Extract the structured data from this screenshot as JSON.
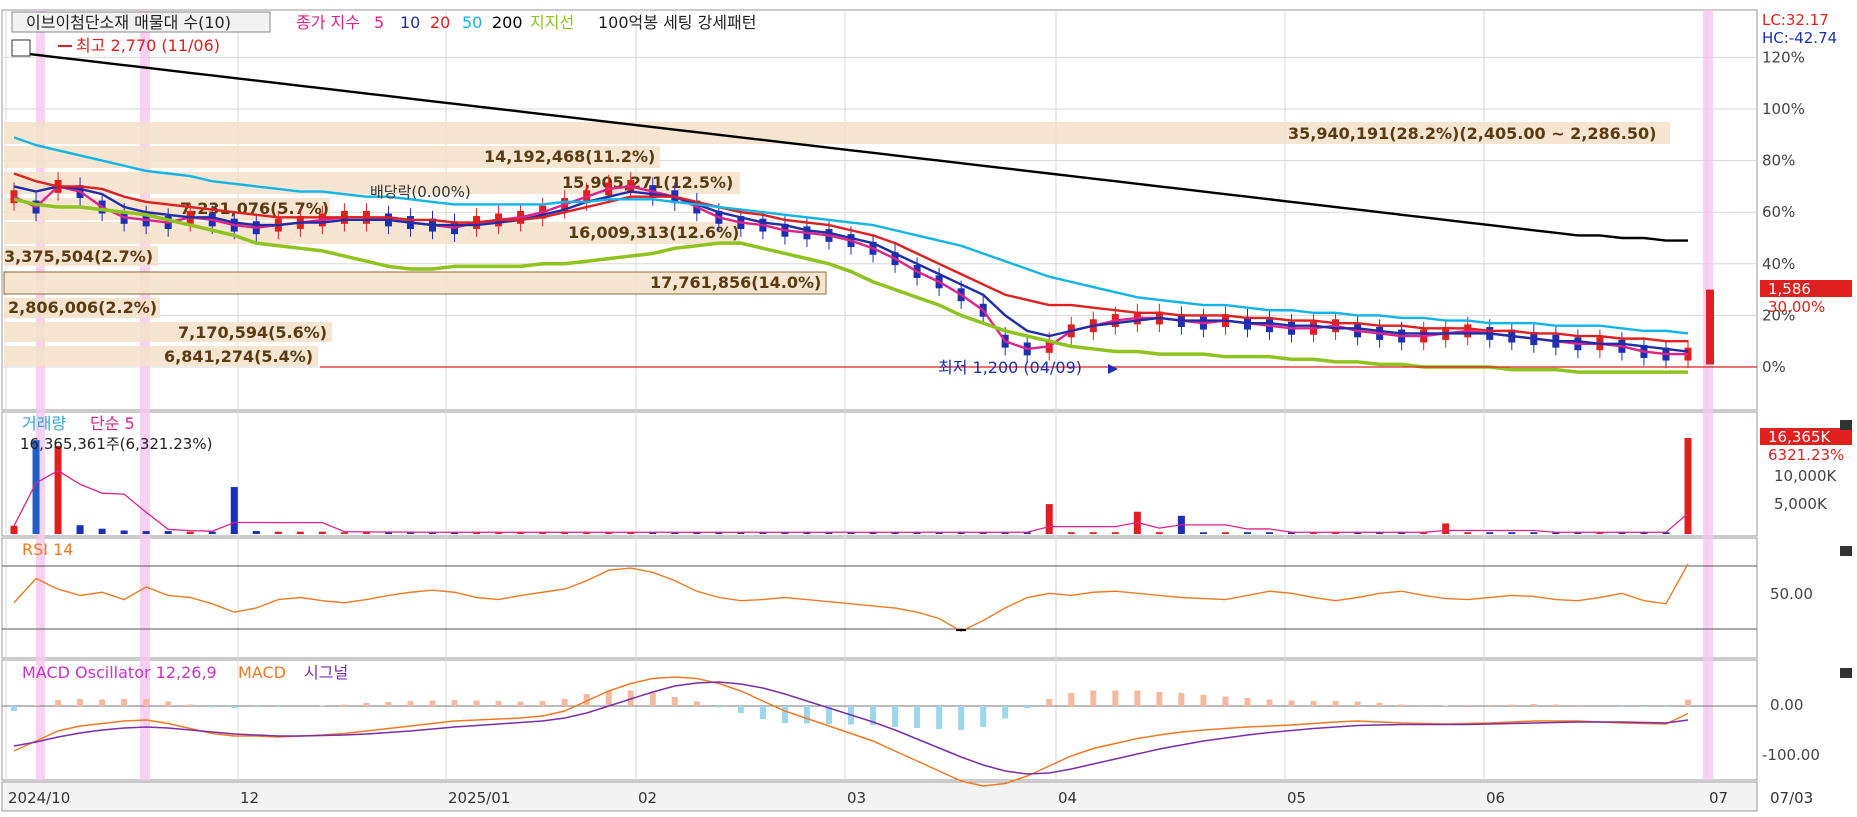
{
  "main_panel": {
    "stock_name": "이브이첨단소재 매물대 수(10)",
    "indicators": [
      {
        "label": "종가 지수",
        "color": "#e0218a"
      },
      {
        "label": "5",
        "color": "#e0218a"
      },
      {
        "label": "10",
        "color": "#1f2ea8"
      },
      {
        "label": "20",
        "color": "#e02020"
      },
      {
        "label": "50",
        "color": "#11b4e8"
      },
      {
        "label": "200",
        "color": "#000000"
      },
      {
        "label": "지지선",
        "color": "#8fc31f"
      },
      {
        "label": "100억봉 세팅 강세패턴",
        "color": "#222222"
      }
    ],
    "right_info": [
      "LC:32.17",
      "HC:-42.74"
    ],
    "high_marker": "최고 2,770 (11/06)",
    "low_marker": "최저 1,200 (04/09)",
    "dividend_marker": "배당락(0.00%)",
    "y_axis": [
      "120%",
      "100%",
      "80%",
      "60%",
      "40%",
      "20%",
      "0%"
    ],
    "price_badge": "1,586",
    "pct_badge": "30.00%"
  },
  "volume_profile": [
    {
      "label": "35,940,191(28.2%)(2,405.00 ~ 2,286.50)"
    },
    {
      "label": "14,192,468(11.2%)"
    },
    {
      "label": "15,905,271(12.5%)"
    },
    {
      "label": "7,231,076(5.7%)"
    },
    {
      "label": "16,009,313(12.6%)"
    },
    {
      "label": "3,375,504(2.7%)"
    },
    {
      "label": "17,761,856(14.0%)"
    },
    {
      "label": "2,806,006(2.2%)"
    },
    {
      "label": "7,170,594(5.6%)"
    },
    {
      "label": "6,841,274(5.4%)"
    }
  ],
  "volume_panel": {
    "title": "거래량",
    "ma_label": "단순 5",
    "info": "16,365,361주(6,321.23%)",
    "y_axis": [
      "10,000K",
      "5,000K"
    ],
    "badge1": "16,365K",
    "badge2": "6321.23%"
  },
  "rsi_panel": {
    "title": "RSI 14",
    "y_axis": [
      "50.00"
    ]
  },
  "macd_panel": {
    "title_osc": "MACD Oscillator 12,26,9",
    "title_macd": "MACD",
    "title_signal": "시그널",
    "y_axis": [
      "0.00",
      "-100.00"
    ]
  },
  "x_axis": [
    {
      "label": "2024/10"
    },
    {
      "label": "12"
    },
    {
      "label": "2025/01"
    },
    {
      "label": "02"
    },
    {
      "label": "03"
    },
    {
      "label": "04"
    },
    {
      "label": "05"
    },
    {
      "label": "06"
    },
    {
      "label": "07"
    }
  ],
  "x_axis_right": "07/03",
  "chart_data": {
    "type": "line",
    "x_axis_months": [
      "2024/10",
      "12",
      "2025/01",
      "02",
      "03",
      "04",
      "05",
      "06",
      "07"
    ],
    "price_high": 2770,
    "price_high_date": "11/06",
    "price_low": 1200,
    "price_low_date": "04/09",
    "price_last": 1586,
    "change_pct_last": 30.0,
    "y_axis_pct": [
      120,
      100,
      80,
      60,
      40,
      20,
      0
    ],
    "series": [
      {
        "name": "5",
        "color": "#e0218a",
        "y_pct": [
          66,
          62,
          70,
          68,
          62,
          58,
          57,
          56,
          58,
          57,
          55,
          54,
          55,
          56,
          57,
          58,
          58,
          57,
          56,
          55,
          54,
          56,
          57,
          58,
          60,
          63,
          66,
          69,
          70,
          68,
          66,
          62,
          58,
          56,
          55,
          53,
          52,
          51,
          49,
          46,
          42,
          37,
          33,
          28,
          22,
          10,
          7,
          8,
          14,
          16,
          18,
          19,
          19,
          18,
          17,
          18,
          17,
          16,
          15,
          15,
          16,
          14,
          13,
          12,
          12,
          13,
          14,
          13,
          12,
          11,
          10,
          9,
          9,
          8,
          6,
          5,
          5
        ]
      },
      {
        "name": "10",
        "color": "#1f2ea8",
        "y_pct": [
          70,
          68,
          70,
          69,
          67,
          62,
          60,
          59,
          58,
          58,
          56,
          55,
          55,
          56,
          56,
          57,
          57,
          57,
          56,
          55,
          55,
          55,
          56,
          57,
          59,
          61,
          64,
          66,
          68,
          67,
          66,
          63,
          60,
          58,
          56,
          55,
          53,
          52,
          50,
          48,
          44,
          40,
          36,
          32,
          28,
          20,
          14,
          12,
          14,
          16,
          17,
          18,
          19,
          18,
          18,
          18,
          17,
          17,
          16,
          16,
          15,
          15,
          14,
          13,
          13,
          13,
          13,
          13,
          12,
          11,
          10,
          10,
          9,
          9,
          8,
          7,
          6
        ]
      },
      {
        "name": "20",
        "color": "#e02020",
        "y_pct": [
          75,
          72,
          70,
          70,
          69,
          66,
          64,
          63,
          62,
          61,
          60,
          59,
          58,
          58,
          58,
          58,
          58,
          58,
          57,
          57,
          56,
          56,
          57,
          57,
          58,
          60,
          62,
          64,
          66,
          66,
          66,
          64,
          62,
          60,
          59,
          57,
          56,
          55,
          53,
          51,
          48,
          44,
          40,
          36,
          32,
          28,
          26,
          24,
          24,
          23,
          22,
          21,
          21,
          20,
          20,
          20,
          19,
          19,
          18,
          18,
          17,
          17,
          16,
          16,
          15,
          15,
          15,
          14,
          14,
          13,
          13,
          12,
          12,
          11,
          11,
          10,
          10
        ]
      },
      {
        "name": "50",
        "color": "#11b4e8",
        "y_pct": [
          89,
          86,
          84,
          82,
          80,
          78,
          76,
          75,
          74,
          72,
          71,
          70,
          69,
          68,
          68,
          67,
          66,
          66,
          65,
          64,
          63,
          63,
          63,
          63,
          63,
          64,
          64,
          65,
          65,
          65,
          64,
          63,
          62,
          61,
          60,
          59,
          58,
          57,
          56,
          55,
          53,
          51,
          49,
          47,
          44,
          41,
          38,
          35,
          33,
          31,
          29,
          27,
          26,
          25,
          24,
          24,
          23,
          22,
          22,
          21,
          21,
          20,
          20,
          19,
          19,
          18,
          18,
          17,
          17,
          17,
          16,
          16,
          16,
          15,
          14,
          14,
          13
        ]
      },
      {
        "name": "200",
        "color": "#000000",
        "y_pct": [
          122,
          121,
          120,
          119,
          118,
          117,
          116,
          115,
          114,
          113,
          112,
          111,
          110,
          109,
          108,
          107,
          106,
          105,
          104,
          103,
          102,
          101,
          100,
          99,
          98,
          97,
          96,
          95,
          94,
          93,
          92,
          91,
          90,
          89,
          88,
          87,
          86,
          85,
          84,
          83,
          82,
          81,
          80,
          79,
          78,
          77,
          76,
          75,
          74,
          73,
          72,
          71,
          70,
          69,
          68,
          67,
          66,
          65,
          64,
          63,
          62,
          61,
          60,
          59,
          58,
          57,
          56,
          55,
          54,
          53,
          52,
          51,
          51,
          50,
          50,
          49,
          49
        ]
      },
      {
        "name": "지지선",
        "color": "#8fc31f",
        "y_pct": [
          65,
          63,
          62,
          62,
          61,
          60,
          59,
          57,
          55,
          53,
          51,
          48,
          47,
          46,
          45,
          43,
          41,
          39,
          38,
          38,
          39,
          39,
          39,
          39,
          40,
          40,
          41,
          42,
          43,
          44,
          46,
          47,
          48,
          48,
          46,
          44,
          42,
          40,
          37,
          33,
          30,
          27,
          24,
          20,
          17,
          14,
          12,
          10,
          8,
          7,
          6,
          6,
          5,
          5,
          5,
          4,
          4,
          4,
          3,
          3,
          2,
          2,
          1,
          1,
          0,
          0,
          0,
          0,
          -1,
          -1,
          -1,
          -2,
          -2,
          -2,
          -2,
          -2,
          -2
        ]
      }
    ],
    "volume_k": [
      1400,
      16000,
      15000,
      1500,
      900,
      600,
      500,
      500,
      400,
      400,
      8000,
      500,
      400,
      400,
      400,
      300,
      300,
      300,
      300,
      300,
      300,
      300,
      300,
      300,
      300,
      300,
      300,
      300,
      300,
      300,
      300,
      300,
      300,
      300,
      300,
      300,
      300,
      300,
      300,
      300,
      300,
      300,
      300,
      300,
      300,
      300,
      300,
      5100,
      300,
      300,
      300,
      3800,
      300,
      3100,
      300,
      300,
      300,
      300,
      300,
      300,
      300,
      300,
      300,
      300,
      300,
      1800,
      300,
      300,
      300,
      300,
      300,
      300,
      300,
      300,
      300,
      300,
      16365
    ],
    "rsi": [
      45,
      68,
      58,
      52,
      55,
      48,
      60,
      52,
      50,
      44,
      36,
      40,
      48,
      50,
      47,
      45,
      48,
      52,
      55,
      57,
      55,
      50,
      48,
      52,
      55,
      58,
      66,
      76,
      78,
      74,
      66,
      56,
      50,
      47,
      48,
      50,
      48,
      46,
      44,
      42,
      40,
      36,
      30,
      18,
      28,
      40,
      50,
      54,
      52,
      55,
      56,
      54,
      52,
      50,
      49,
      48,
      52,
      56,
      54,
      50,
      47,
      50,
      54,
      56,
      52,
      49,
      48,
      50,
      52,
      51,
      48,
      47,
      50,
      54,
      47,
      44,
      82
    ],
    "macd": [
      -90,
      -70,
      -50,
      -40,
      -35,
      -30,
      -28,
      -35,
      -45,
      -55,
      -60,
      -60,
      -62,
      -60,
      -58,
      -55,
      -50,
      -45,
      -40,
      -35,
      -30,
      -28,
      -26,
      -24,
      -20,
      -10,
      10,
      30,
      45,
      55,
      58,
      55,
      45,
      30,
      10,
      -10,
      -25,
      -40,
      -55,
      -70,
      -90,
      -110,
      -130,
      -150,
      -160,
      -155,
      -140,
      -120,
      -100,
      -85,
      -75,
      -65,
      -58,
      -52,
      -48,
      -45,
      -42,
      -40,
      -38,
      -35,
      -32,
      -30,
      -32,
      -34,
      -35,
      -36,
      -35,
      -34,
      -32,
      -30,
      -30,
      -30,
      -32,
      -34,
      -35,
      -36,
      -15
    ],
    "signal": [
      -80,
      -72,
      -62,
      -54,
      -48,
      -44,
      -42,
      -44,
      -48,
      -52,
      -56,
      -58,
      -60,
      -60,
      -59,
      -58,
      -56,
      -53,
      -50,
      -46,
      -42,
      -39,
      -36,
      -33,
      -30,
      -24,
      -14,
      0,
      14,
      28,
      40,
      46,
      48,
      44,
      36,
      24,
      10,
      -4,
      -18,
      -32,
      -48,
      -66,
      -84,
      -102,
      -118,
      -130,
      -136,
      -134,
      -126,
      -116,
      -106,
      -96,
      -86,
      -78,
      -70,
      -64,
      -58,
      -53,
      -49,
      -45,
      -42,
      -39,
      -38,
      -37,
      -37,
      -37,
      -37,
      -36,
      -35,
      -34,
      -33,
      -32,
      -32,
      -32,
      -33,
      -34,
      -28
    ],
    "macd_osc": [
      -10,
      2,
      12,
      14,
      13,
      14,
      14,
      9,
      3,
      -3,
      -4,
      -2,
      -2,
      0,
      1,
      3,
      6,
      8,
      10,
      11,
      12,
      11,
      10,
      9,
      10,
      14,
      24,
      30,
      31,
      27,
      18,
      9,
      -3,
      -14,
      -26,
      -34,
      -35,
      -36,
      -37,
      -38,
      -42,
      -44,
      -46,
      -48,
      -42,
      -25,
      -4,
      14,
      26,
      31,
      31,
      31,
      28,
      26,
      22,
      19,
      16,
      13,
      11,
      10,
      10,
      9,
      6,
      3,
      2,
      1,
      2,
      2,
      3,
      4,
      3,
      2,
      0,
      -2,
      -2,
      -2,
      13
    ]
  }
}
